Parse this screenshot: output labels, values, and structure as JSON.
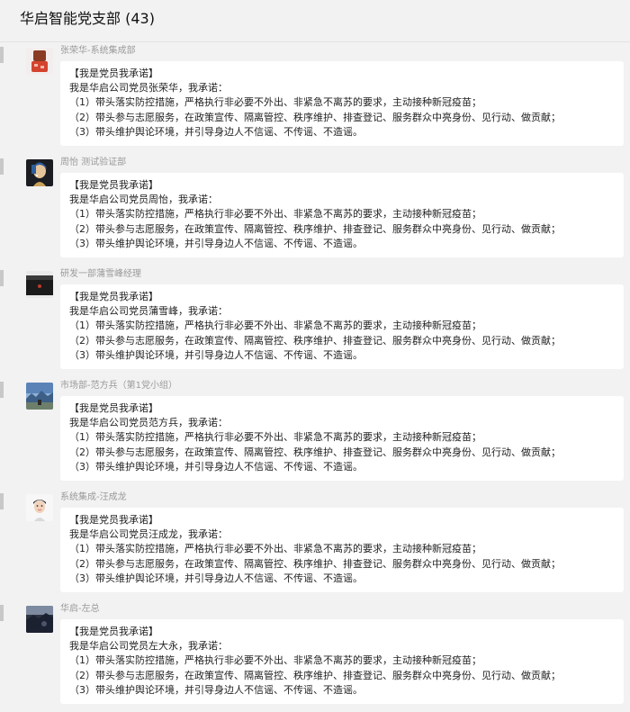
{
  "group": {
    "title": "华启智能党支部 (43)"
  },
  "messages": [
    {
      "sender": "张荣华-系统集成部",
      "avatar_icon": "photo-avatar-red-object",
      "lines": [
        "【我是党员我承诺】",
        "我是华启公司党员张荣华，我承诺：",
        "（1）带头落实防控措施，严格执行非必要不外出、非紧急不离苏的要求，主动接种新冠疫苗；",
        "（2）带头参与志愿服务，在政策宣传、隔离管控、秩序维护、排查登记、服务群众中亮身份、见行动、做贡献；",
        "（3）带头维护舆论环境，并引导身边人不信谣、不传谣、不造谣。"
      ]
    },
    {
      "sender": "周怡  测试验证部",
      "avatar_icon": "photo-avatar-portrait-painting",
      "lines": [
        "【我是党员我承诺】",
        "我是华启公司党员周怡，我承诺：",
        "（1）带头落实防控措施，严格执行非必要不外出、非紧急不离苏的要求，主动接种新冠疫苗；",
        "（2）带头参与志愿服务，在政策宣传、隔离管控、秩序维护、排查登记、服务群众中亮身份、见行动、做贡献；",
        "（3）带头维护舆论环境，并引导身边人不信谣、不传谣、不造谣。"
      ]
    },
    {
      "sender": "研发一部蒲雪峰经理",
      "avatar_icon": "photo-avatar-dark-device",
      "lines": [
        "【我是党员我承诺】",
        "我是华启公司党员蒲雪峰，我承诺：",
        "（1）带头落实防控措施，严格执行非必要不外出、非紧急不离苏的要求，主动接种新冠疫苗；",
        "（2）带头参与志愿服务，在政策宣传、隔离管控、秩序维护、排查登记、服务群众中亮身份、见行动、做贡献；",
        "（3）带头维护舆论环境，并引导身边人不信谣、不传谣、不造谣。"
      ]
    },
    {
      "sender": "市场部-范方兵（第1党小组）",
      "avatar_icon": "photo-avatar-landscape",
      "lines": [
        "【我是党员我承诺】",
        "我是华启公司党员范方兵，我承诺：",
        "（1）带头落实防控措施，严格执行非必要不外出、非紧急不离苏的要求，主动接种新冠疫苗；",
        "（2）带头参与志愿服务，在政策宣传、隔离管控、秩序维护、排查登记、服务群众中亮身份、见行动、做贡献；",
        "（3）带头维护舆论环境，并引导身边人不信谣、不传谣、不造谣。"
      ]
    },
    {
      "sender": "系统集成-汪成龙",
      "avatar_icon": "photo-avatar-person-face",
      "lines": [
        "【我是党员我承诺】",
        "我是华启公司党员汪成龙，我承诺：",
        "（1）带头落实防控措施，严格执行非必要不外出、非紧急不离苏的要求，主动接种新冠疫苗；",
        "（2）带头参与志愿服务，在政策宣传、隔离管控、秩序维护、排查登记、服务群众中亮身份、见行动、做贡献；",
        "（3）带头维护舆论环境，并引导身边人不信谣、不传谣、不造谣。"
      ]
    },
    {
      "sender": "华启-左总",
      "avatar_icon": "photo-avatar-night-scene",
      "lines": [
        "【我是党员我承诺】",
        "我是华启公司党员左大永，我承诺：",
        "（1）带头落实防控措施，严格执行非必要不外出、非紧急不离苏的要求，主动接种新冠疫苗；",
        "（2）带头参与志愿服务，在政策宣传、隔离管控、秩序维护、排查登记、服务群众中亮身份、见行动、做贡献；",
        "（3）带头维护舆论环境，并引导身边人不信谣、不传谣、不造谣。"
      ]
    }
  ]
}
